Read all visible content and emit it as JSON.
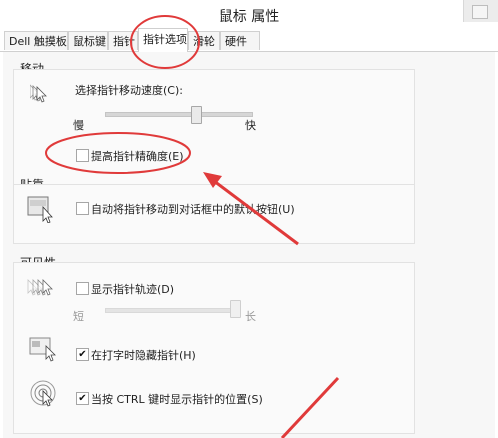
{
  "window": {
    "title": "鼠标 属性"
  },
  "tabs": [
    {
      "label": "Dell 触摸板"
    },
    {
      "label": "鼠标键"
    },
    {
      "label": "指针"
    },
    {
      "label": "指针选项"
    },
    {
      "label": "滑轮"
    },
    {
      "label": "硬件"
    }
  ],
  "motion": {
    "group_label": "移动",
    "speed_label": "选择指针移动速度(C):",
    "slow_label": "慢",
    "fast_label": "快",
    "speed_level": 0.62,
    "precision_label": "提高指针精确度(E)",
    "precision_checked": false
  },
  "snap": {
    "group_label": "贴靠",
    "snap_label": "自动将指针移动到对话框中的默认按钮(U)",
    "snap_checked": false
  },
  "visibility": {
    "group_label": "可见性",
    "trails_label": "显示指针轨迹(D)",
    "trails_checked": false,
    "short_label": "短",
    "long_label": "长",
    "trail_level": 1.0,
    "hide_label": "在打字时隐藏指针(H)",
    "hide_checked": true,
    "ctrl_label": "当按 CTRL 键时显示指针的位置(S)",
    "ctrl_checked": true
  },
  "colors": {
    "annotation": "#e03a3a",
    "accent": "#1a1a1a"
  }
}
